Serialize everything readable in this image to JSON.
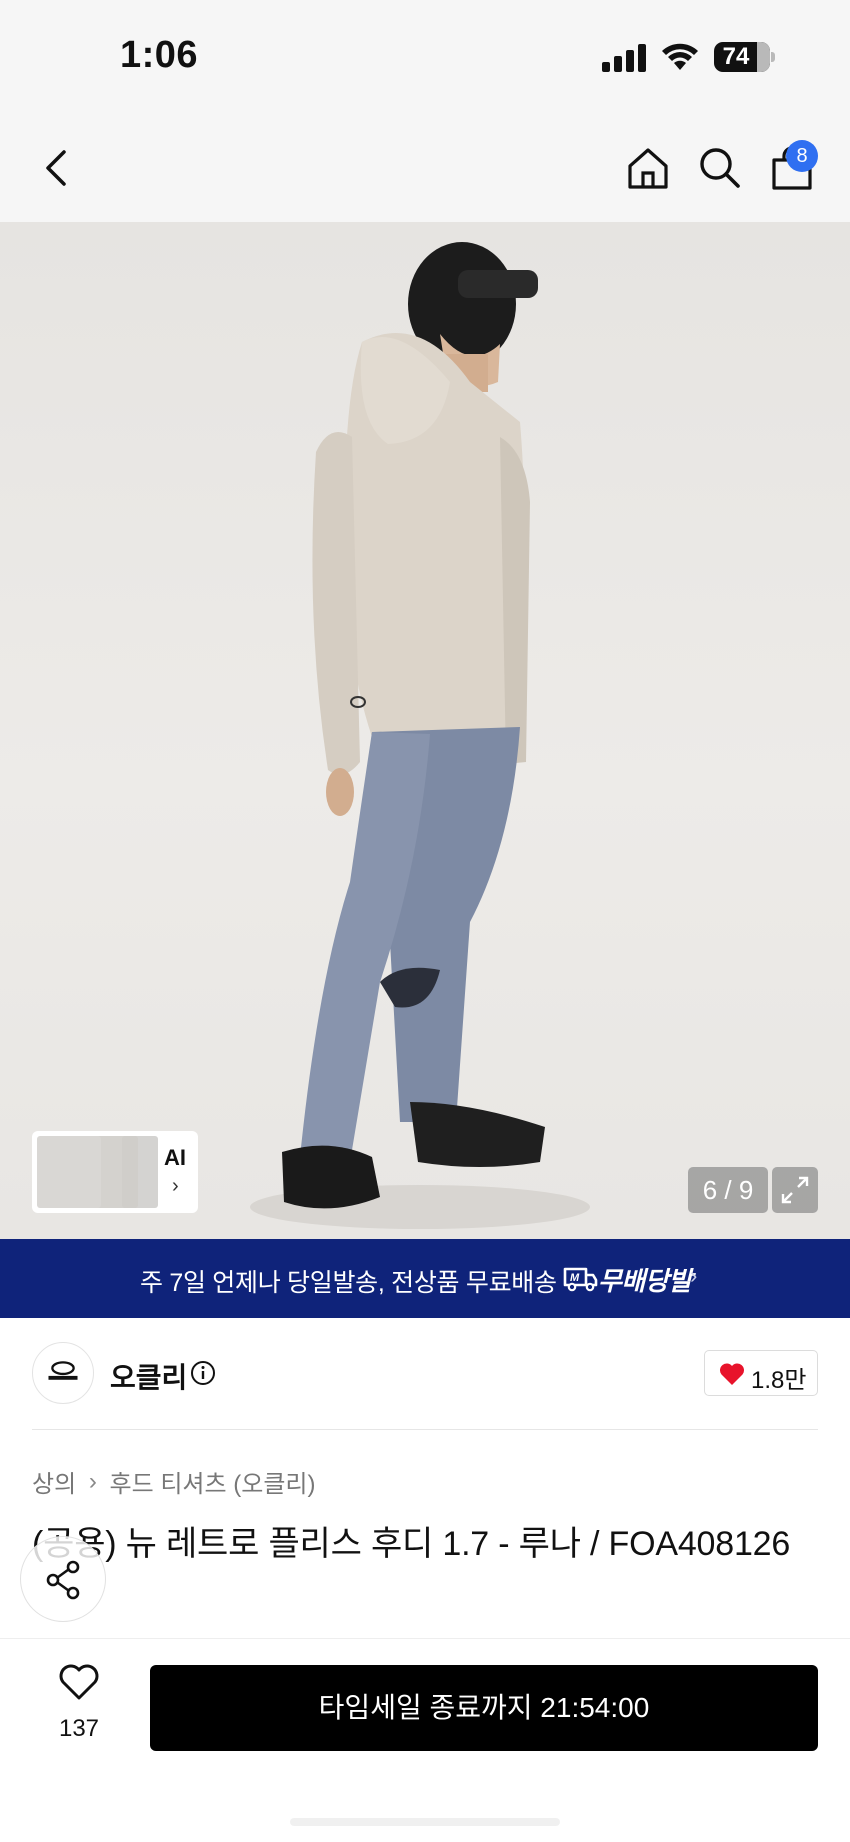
{
  "status_bar": {
    "time": "1:06",
    "battery": "74"
  },
  "nav": {
    "cart_count": "8",
    "icons": [
      "back-icon",
      "home-icon",
      "search-icon",
      "cart-icon"
    ]
  },
  "gallery": {
    "ai_label": "AI",
    "page_counter": "6 / 9"
  },
  "promo_banner": {
    "text": "주 7일 언제나 당일발송, 전상품 무료배송",
    "brand": "무배당발",
    "background": "#0f237a"
  },
  "brand": {
    "name": "오클리",
    "like_count": "1.8만"
  },
  "breadcrumb": [
    "상의",
    "후드 티셔츠 (오클리)"
  ],
  "product": {
    "title": "(공용) 뉴 레트로 플리스 후디 1.7 - 루나 / FOA408126"
  },
  "bottom_bar": {
    "wish_count": "137",
    "cta_label": "타임세일 종료까지 21:54:00",
    "cta_color": "#000000"
  },
  "colors": {
    "badge": "#2f6ff1",
    "heart": "#e8132b"
  }
}
